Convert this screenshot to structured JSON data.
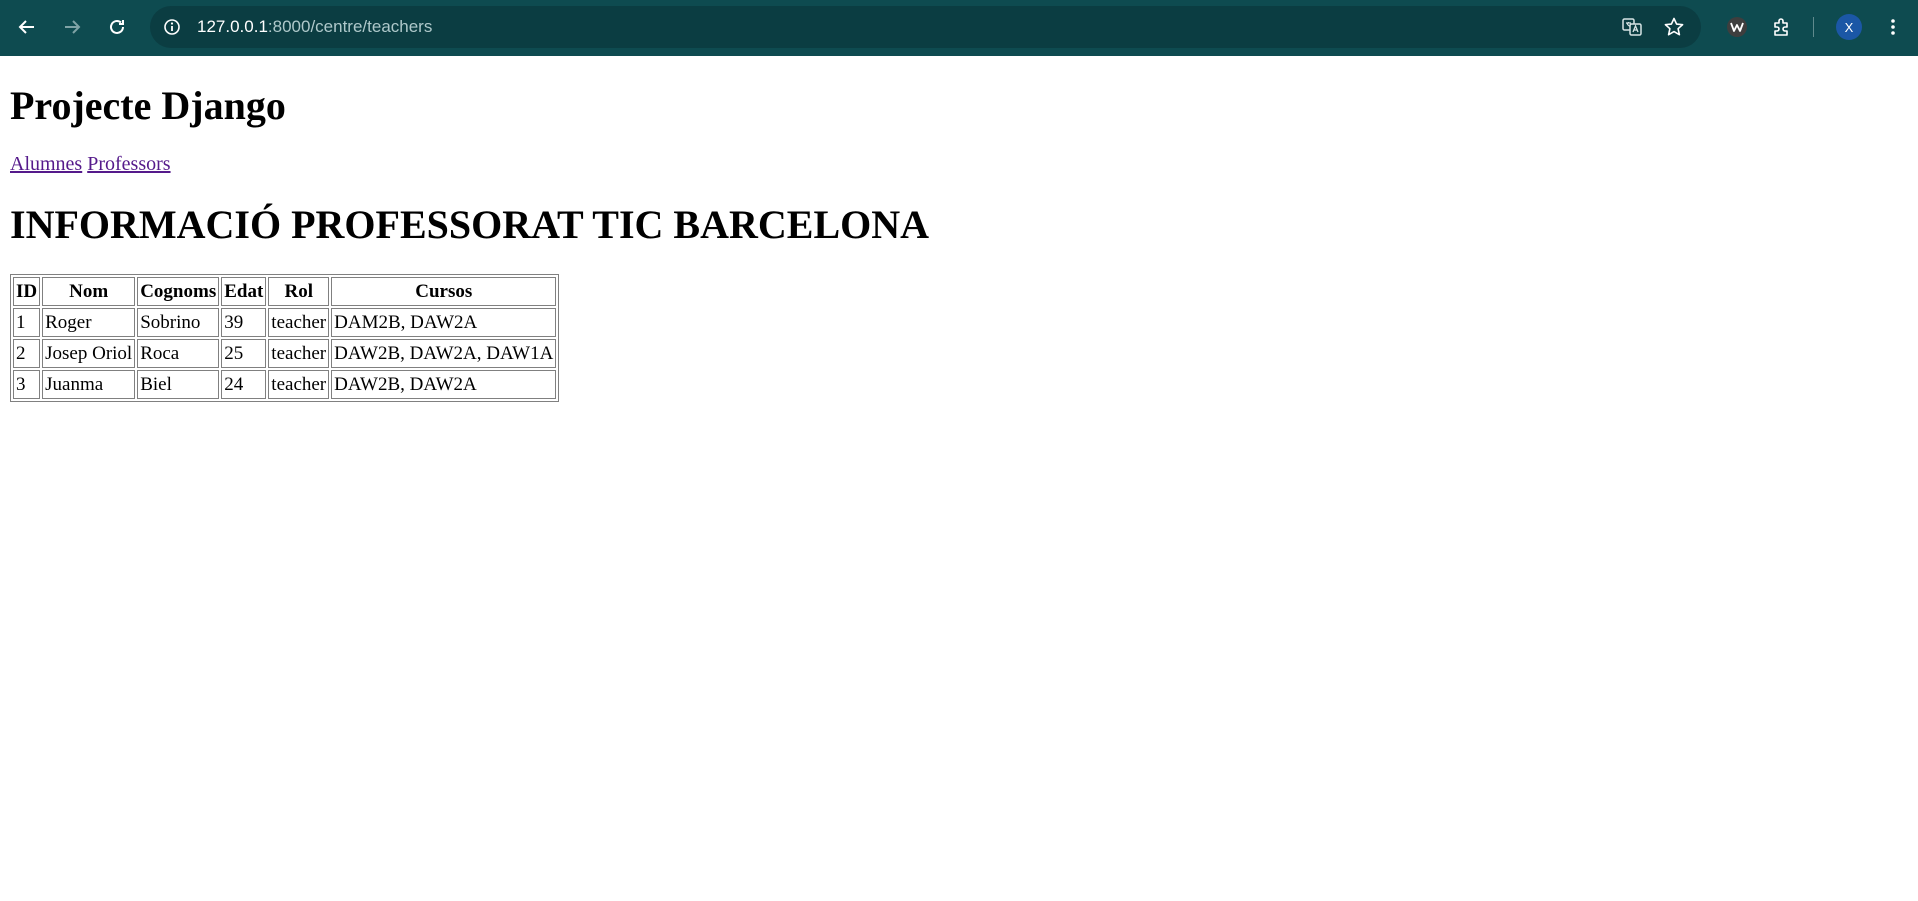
{
  "browser": {
    "url_host": "127.0.0.1",
    "url_path": ":8000/centre/teachers",
    "profile_initial": "X",
    "icons": [
      "back-arrow-icon",
      "forward-arrow-icon",
      "reload-icon",
      "site-info-icon",
      "translate-icon",
      "bookmark-star-icon",
      "extension-w-icon",
      "extensions-puzzle-icon",
      "kebab-menu-icon"
    ],
    "colors": {
      "toolbar": "#0e4b50",
      "omnibox": "#0b3d42",
      "avatar": "#1b57a6",
      "link_visited": "#551a8b"
    }
  },
  "page": {
    "site_title": "Projecte Django",
    "nav": {
      "students": "Alumnes",
      "teachers": "Professors"
    },
    "heading": "INFORMACIÓ PROFESSORAT TIC BARCELONA",
    "table": {
      "headers": [
        "ID",
        "Nom",
        "Cognoms",
        "Edat",
        "Rol",
        "Cursos"
      ],
      "rows": [
        [
          "1",
          "Roger",
          "Sobrino",
          "39",
          "teacher",
          "DAM2B, DAW2A"
        ],
        [
          "2",
          "Josep Oriol",
          "Roca",
          "25",
          "teacher",
          "DAW2B, DAW2A, DAW1A"
        ],
        [
          "3",
          "Juanma",
          "Biel",
          "24",
          "teacher",
          "DAW2B, DAW2A"
        ]
      ]
    }
  }
}
